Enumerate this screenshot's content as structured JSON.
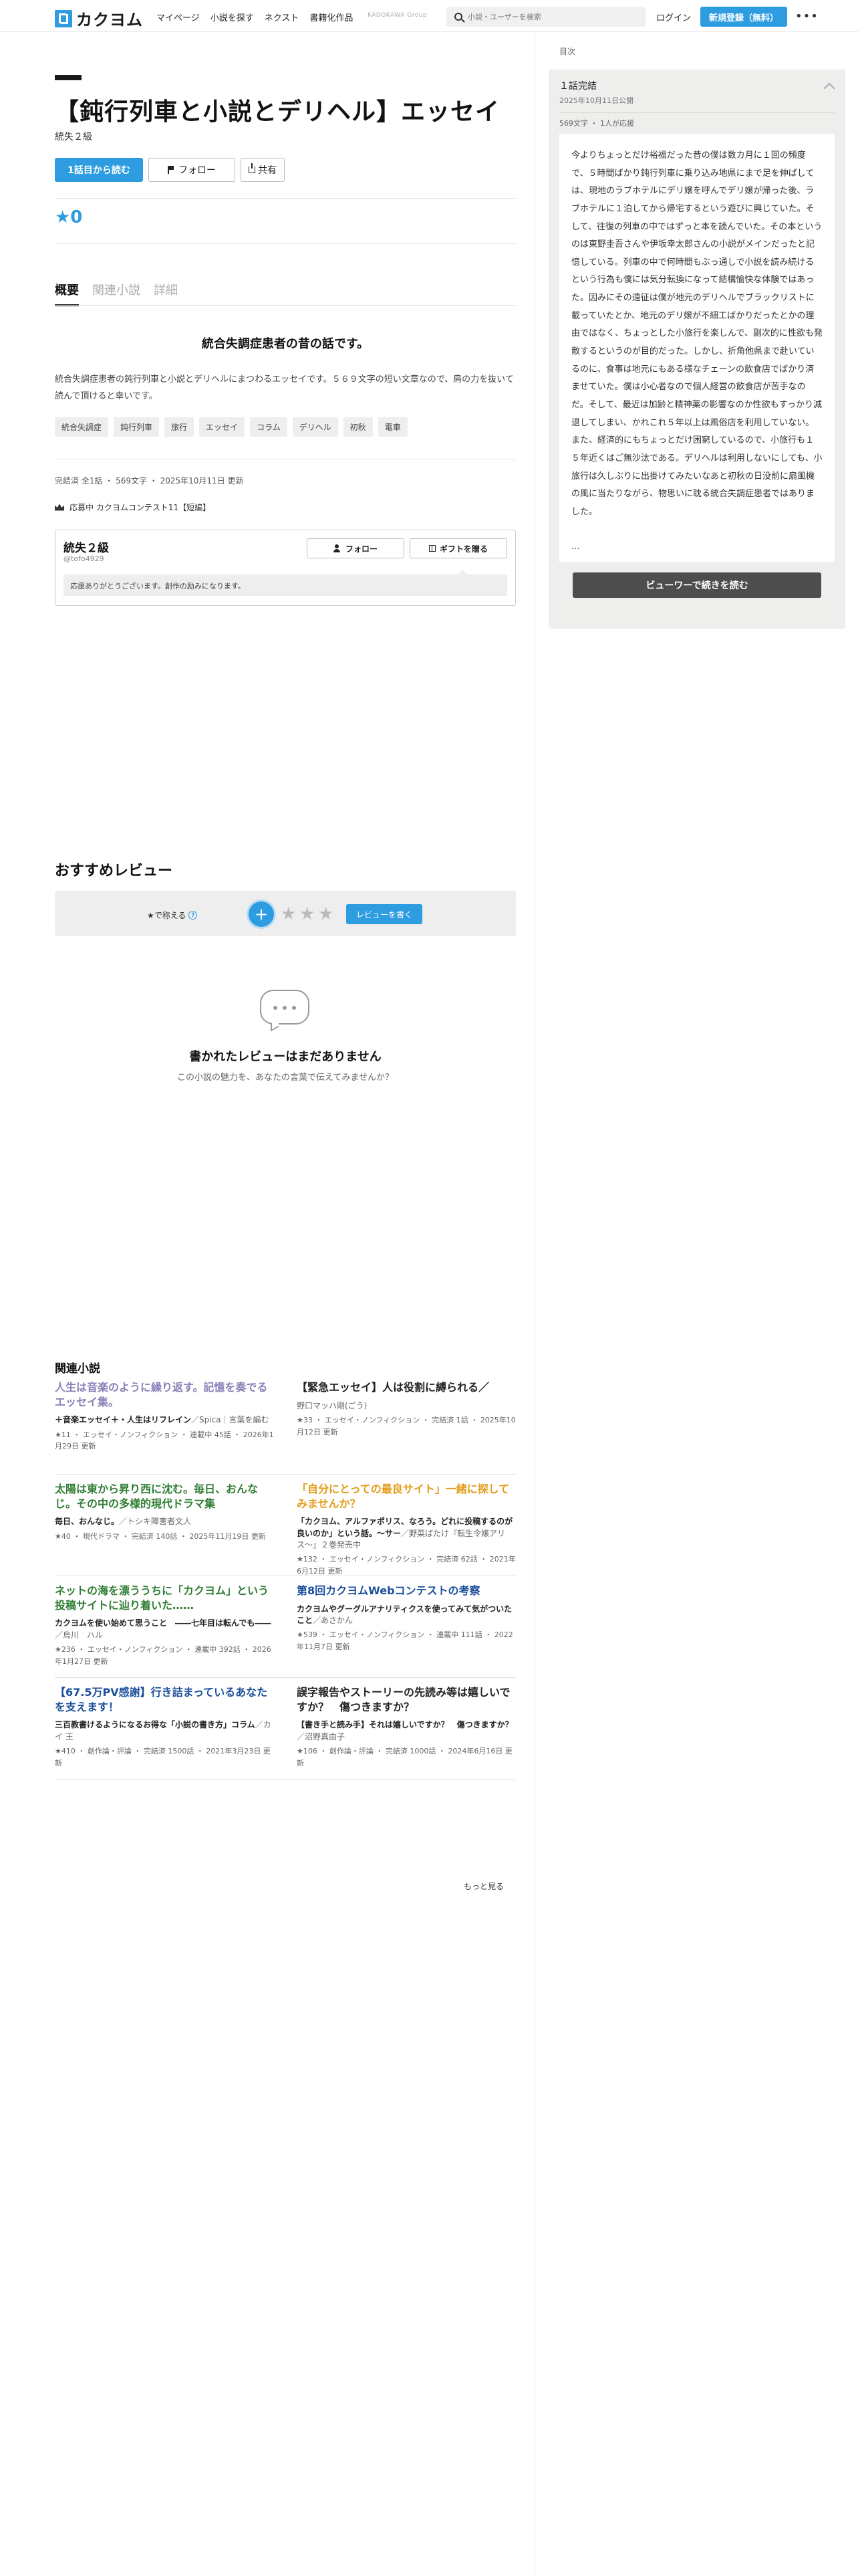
{
  "header": {
    "logo_text": "カクヨム",
    "nav": [
      "マイページ",
      "小説を探す",
      "ネクスト",
      "書籍化作品"
    ],
    "kadokawa": "KADOKAWA Group",
    "search_placeholder": "小説・ユーザーを検索",
    "login": "ログイン",
    "signup": "新規登録（無料）",
    "more": "•••",
    "brand_color": "#2d9ce0"
  },
  "work": {
    "title": "【鈍行列車と小説とデリヘル】エッセイ",
    "author": "統失２級",
    "read_button": "1話目から読む",
    "follow_button": "フォロー",
    "share_button": "共有",
    "rating": "★0",
    "tabs": [
      "概要",
      "関連小説",
      "詳細"
    ],
    "catchphrase": "統合失調症患者の昔の話です。",
    "introduction": "統合失調症患者の鈍行列車と小説とデリヘルにまつわるエッセイです。５６９文字の短い文章なので、肩の力を抜いて読んで頂けると幸いです。",
    "tags": [
      "統合失調症",
      "鈍行列車",
      "旅行",
      "エッセイ",
      "コラム",
      "デリヘル",
      "初秋",
      "電車"
    ],
    "status": "完結済 全1話 ・ 569文字 ・ 2025年10月11日 更新",
    "contest": "応募中 カクヨムコンテスト11【短編】"
  },
  "author_card": {
    "name": "統失２級",
    "id": "@tofo4929",
    "follow": "フォロー",
    "gift": "ギフトを贈る",
    "message": "応援ありがとうございます。創作の励みになります。"
  },
  "reviews": {
    "heading": "おすすめレビュー",
    "rate_label": "★で称える",
    "help": "?",
    "plus": "+",
    "stars": [
      "★",
      "★",
      "★"
    ],
    "write": "レビューを書く",
    "empty_title": "書かれたレビューはまだありません",
    "empty_sub": "この小説の魅力を、あなたの言葉で伝えてみませんか？"
  },
  "related": {
    "heading": "関連小説",
    "more": "もっと見る",
    "items": [
      {
        "title": "人生は音楽のように繰り返す。記憶を奏でるエッセイ集。",
        "title_color": "#8a7fb8",
        "catch": "＋音楽エッセイ＋・人生はリフレイン",
        "author": "／Spica｜言葉を編む",
        "meta": "★11 ・ エッセイ・ノンフィクション ・ 連載中 45話 ・ 2026年1月29日 更新"
      },
      {
        "title": "【緊急エッセイ】人は役割に縛られる／",
        "title_color": "#222222",
        "catch": "",
        "author": "野口マッハ剛(ごう)",
        "meta": "★33 ・ エッセイ・ノンフィクション ・ 完結済 1話 ・ 2025年10月12日 更新"
      },
      {
        "title": "太陽は東から昇り西に沈む。毎日、おんなじ。その中の多様的現代ドラマ集",
        "title_color": "#2e7d32",
        "catch": "毎日、おんなじ。",
        "author": "／トシキ障害者文人",
        "meta": "★40 ・ 現代ドラマ ・ 完結済 140話 ・ 2025年11月19日 更新"
      },
      {
        "title": "「自分にとっての最良サイト」一緒に探してみませんか？",
        "title_color": "#e39b17",
        "catch": "「カクヨム、アルファポリス、なろう。どれに投稿するのが良いのか」という話。〜サー",
        "author": "／野菜ばたけ『転生令嬢アリス〜』２巻発売中",
        "meta": "★132 ・ エッセイ・ノンフィクション ・ 完結済 62話 ・ 2021年6月12日 更新"
      },
      {
        "title": "ネットの海を漂ううちに「カクヨム」という投稿サイトに辿り着いた……",
        "title_color": "#2e7d32",
        "catch": "カクヨムを使い始めて思うこと　――七年目は転んでも――",
        "author": "／烏川　ハル",
        "meta": "★236 ・ エッセイ・ノンフィクション ・ 連載中 392話 ・ 2026年1月27日 更新"
      },
      {
        "title": "第8回カクヨムWebコンテストの考察",
        "title_color": "#1a4f9c",
        "catch": "カクヨムやグーグルアナリティクスを使ってみて気がついたこと",
        "author": "／あさかん",
        "meta": "★539 ・ エッセイ・ノンフィクション ・ 連載中 111話 ・ 2022年11月7日 更新"
      },
      {
        "title": "【67.5万PV感謝】行き詰まっているあなたを支えます！",
        "title_color": "#1a4f9c",
        "catch": "三百教書けるようになるお得な「小説の書き方」コラム",
        "author": "／カイ 王",
        "meta": "★410 ・ 創作論・評論 ・ 完結済 1500話 ・ 2021年3月23日 更新"
      },
      {
        "title": "誤字報告やストーリーの先読み等は嬉しいですか？　傷つきますか？",
        "title_color": "#222222",
        "catch": "【書き手と読み手】それは嬉しいですか？　傷つきますか？",
        "author": "／沼野真由子",
        "meta": "★106 ・ 創作論・評論 ・ 完結済 1000話 ・ 2024年6月16日 更新"
      }
    ]
  },
  "episode_panel": {
    "toc_label": "目次",
    "title": "１話完結",
    "date": "2025年10月11日公開",
    "meta": "569文字 ・ 1人が応援",
    "text": "今よりちょっとだけ裕福だった昔の僕は数カ月に１回の頻度で、５時間ばかり鈍行列車に乗り込み地県にまで足を伸ばしては、現地のラブホテルにデリ嬢を呼んでデリ嬢が帰った後、ラブホテルに１泊してから帰宅するという遊びに興じていた。そして、往復の列車の中ではずっと本を読んでいた。その本というのは東野圭吾さんや伊坂幸太郎さんの小説がメインだったと記憶している。列車の中で何時間もぶっ通しで小説を読み続けるという行為も僕には気分転換になって結構愉快な体験ではあった。因みにその遠征は僕が地元のデリヘルでブラックリストに載っていたとか、地元のデリ嬢が不細工ばかりだったとかの理由ではなく、ちょっとした小旅行を楽しんで、副次的に性欲も発散するというのが目的だった。しかし、折角他県まで赴いているのに、食事は地元にもある様なチェーンの飲食店でばかり済ませていた。僕は小心者なので個人経営の飲食店が苦手なのだ。そして、最近は加齢と精神薬の影響なのか性欲もすっかり減退してしまい、かれこれ５年以上は風俗店を利用していない。また、経済的にもちょっとだけ困窮しているので、小旅行も１５年近くはご無沙汰である。デリヘルは利用しないにしても、小旅行は久しぶりに出掛けてみたいなあと初秋の日没前に扇風機の風に当たりながら、物思いに耽る統合失調症患者ではありました。",
    "ellipsis": "...",
    "viewer_button": "ビューワーで続きを読む"
  }
}
